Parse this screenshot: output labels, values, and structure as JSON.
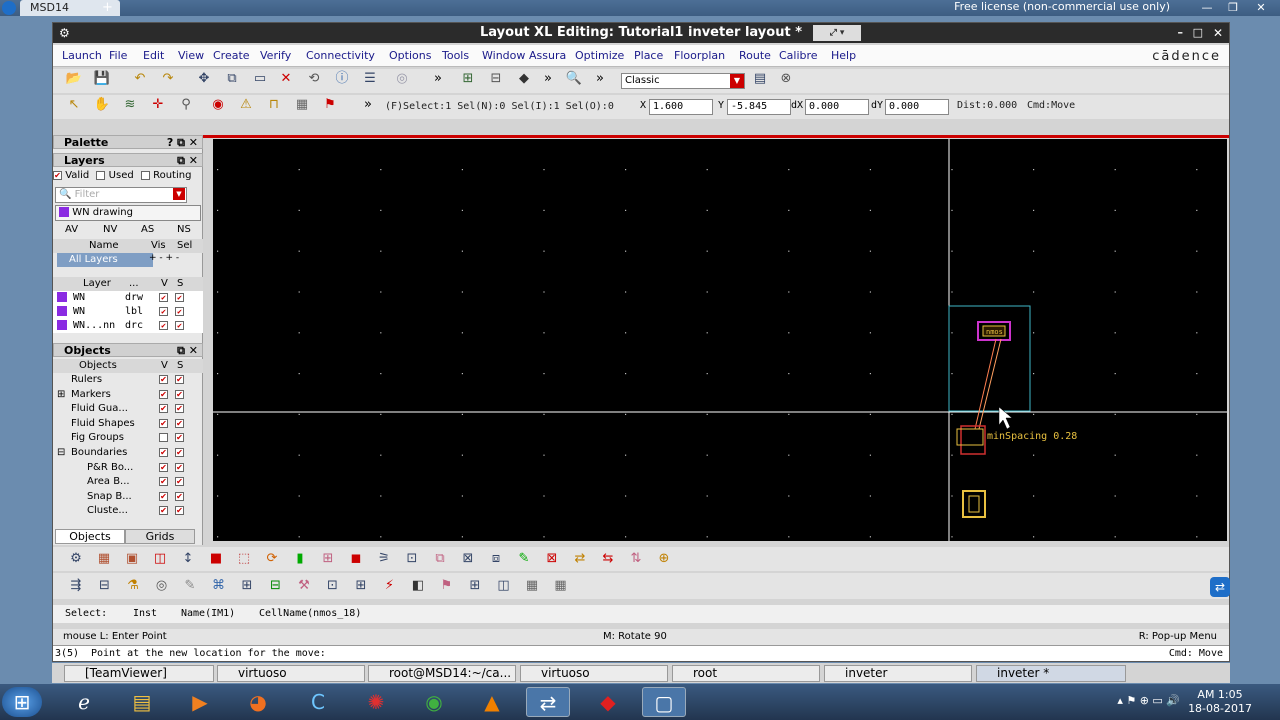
{
  "remote": {
    "tab": "MSD14",
    "license": "Free license (non-commercial use only)"
  },
  "window": {
    "title": "Layout XL Editing: Tutorial1 inveter layout *",
    "menus": [
      "Launch",
      "File",
      "Edit",
      "View",
      "Create",
      "Verify",
      "Connectivity",
      "Options",
      "Tools",
      "Window",
      "Assura",
      "Optimize",
      "Place",
      "Floorplan",
      "Route",
      "Calibre",
      "Help"
    ],
    "logo": "cādence",
    "view_mode": "Classic"
  },
  "status": {
    "select": "(F)Select:1",
    "seln": "Sel(N):0",
    "seli": "Sel(I):1",
    "selo": "Sel(O):0",
    "x_label": "X",
    "x": "1.600",
    "y_label": "Y",
    "y": "-5.845",
    "dx_label": "dX",
    "dx": "0.000",
    "dy_label": "dY",
    "dy": "0.000",
    "dist": "Dist:0.000",
    "cmd": "Cmd:Move"
  },
  "palette": {
    "title": "Palette",
    "layers_title": "Layers",
    "valid": "Valid",
    "used": "Used",
    "routing": "Routing",
    "filter_placeholder": "Filter",
    "current_layer": "WN drawing",
    "av": "AV",
    "nv": "NV",
    "as": "AS",
    "ns": "NS",
    "name_col": "Name",
    "vis_col": "Vis",
    "sel_col": "Sel",
    "all_layers": "All Layers",
    "layer_col": "Layer",
    "dots_col": "...",
    "v_col": "V",
    "s_col": "S",
    "layers": [
      {
        "name": "WN",
        "purpose": "drw"
      },
      {
        "name": "WN",
        "purpose": "lbl"
      },
      {
        "name": "WN...nn",
        "purpose": "drc"
      }
    ],
    "objects_title": "Objects",
    "objects_header": "Objects",
    "objects": [
      "Rulers",
      "Markers",
      "Fluid Gua...",
      "Fluid Shapes",
      "Fig Groups",
      "Boundaries",
      "P&R Bo...",
      "Area B...",
      "Snap B...",
      "Cluste..."
    ],
    "tabs": [
      "Objects",
      "Grids"
    ]
  },
  "canvas": {
    "annotation": "minSpacing 0.28",
    "cell_label": "nmos"
  },
  "info": {
    "select": "Select:",
    "inst": "Inst",
    "name": "Name(IM1)",
    "cell": "CellName(nmos_18)"
  },
  "mouse": {
    "left": "mouse L: Enter Point",
    "mid": "M: Rotate 90",
    "right": "R: Pop-up Menu"
  },
  "cmd": {
    "prompt": "3(5)",
    "message": "Point at the new location for the move:",
    "mode": "Cmd: Move"
  },
  "apps": [
    "[TeamViewer]",
    "virtuoso",
    "root@MSD14:~/ca...",
    "virtuoso",
    "root",
    "inveter",
    "inveter *"
  ],
  "clock": {
    "time": "AM 1:05",
    "date": "18-08-2017"
  }
}
